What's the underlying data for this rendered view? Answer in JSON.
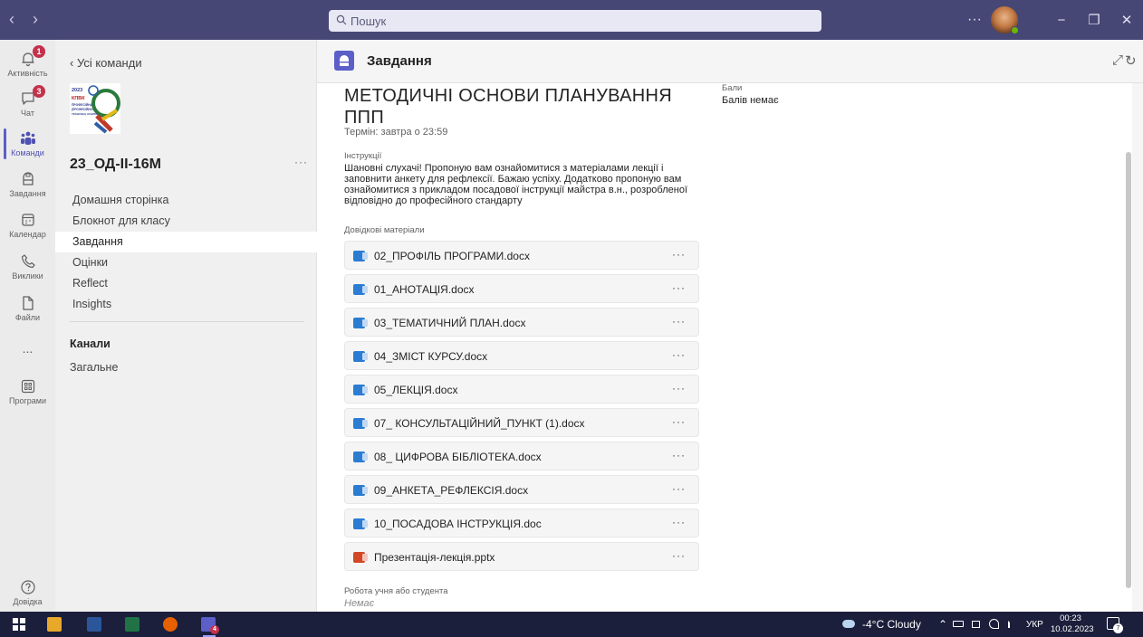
{
  "titlebar": {
    "back_arrow": "‹",
    "forward_arrow": "›",
    "search_placeholder": "Пошук",
    "more": "···",
    "minimize": "−",
    "maximize": "❐",
    "close": "✕"
  },
  "rail": [
    {
      "label": "Активність",
      "icon": "bell-icon",
      "badge": "1"
    },
    {
      "label": "Чат",
      "icon": "chat-icon",
      "badge": "3"
    },
    {
      "label": "Команди",
      "icon": "teams-icon",
      "active": true
    },
    {
      "label": "Завдання",
      "icon": "assignments-icon"
    },
    {
      "label": "Календар",
      "icon": "calendar-icon"
    },
    {
      "label": "Виклики",
      "icon": "phone-icon"
    },
    {
      "label": "Файли",
      "icon": "file-icon"
    },
    {
      "label": "...",
      "icon": "more-icon"
    },
    {
      "label": "Програми",
      "icon": "apps-icon"
    },
    {
      "label": "Довідка",
      "icon": "help-icon"
    }
  ],
  "team": {
    "back_label": "‹  Усі команди",
    "name": "23_ОД-ІІ-16М",
    "more": "···",
    "logo_text": [
      "2023",
      "КПВК",
      "ПРОФЕСІЙНА",
      "(ПРОФЕСІЙНО-",
      "ТЕХНІЧНА) ОСВІТА"
    ],
    "nav": [
      "Домашня сторінка",
      "Блокнот для класу",
      "Завдання",
      "Оцінки",
      "Reflect",
      "Insights"
    ],
    "channels_heading": "Канали",
    "channels": [
      "Загальне"
    ]
  },
  "header": {
    "title": "Завдання",
    "expand_icon": "⤢",
    "refresh_icon": "↻"
  },
  "assignment": {
    "title": "МЕТОДИЧНІ ОСНОВИ ПЛАНУВАННЯ ППП",
    "due": "Термін: завтра о 23:59",
    "instructions_label": "Інструкції",
    "instructions": "Шановні слухачі! Пропоную вам ознайомитися з матеріалами лекції і заповнити анкету для рефлексії. Бажаю успіху. Додатково пропоную вам ознайомитися з прикладом посадової інструкції майстра в.н., розробленої відповідно до професійного стандарту",
    "points_label": "Бали",
    "points_value": "Балів немає",
    "materials_label": "Довідкові матеріали",
    "files": [
      {
        "name": "02_ПРОФІЛЬ ПРОГРАМИ.docx",
        "type": "doc"
      },
      {
        "name": "01_АНОТАЦІЯ.docx",
        "type": "doc"
      },
      {
        "name": "03_ТЕМАТИЧНИЙ ПЛАН.docx",
        "type": "doc"
      },
      {
        "name": "04_ЗМІСТ КУРСУ.docx",
        "type": "doc"
      },
      {
        "name": "05_ЛЕКЦІЯ.docx",
        "type": "doc"
      },
      {
        "name": "07_ КОНСУЛЬТАЦІЙНИЙ_ПУНКТ (1).docx",
        "type": "doc"
      },
      {
        "name": "08_ ЦИФРОВА БІБЛІОТЕКА.docx",
        "type": "doc"
      },
      {
        "name": "09_АНКЕТА_РЕФЛЕКСІЯ.docx",
        "type": "doc"
      },
      {
        "name": "10_ПОСАДОВА ІНСТРУКЦІЯ.doc",
        "type": "doc"
      },
      {
        "name": "Презентація-лекція.pptx",
        "type": "ppt"
      }
    ],
    "file_more": "···",
    "student_work_label": "Робота учня або студента",
    "student_work_value": "Немає"
  },
  "taskbar": {
    "weather": "-4°C  Cloudy",
    "language": "УКР",
    "time": "00:23",
    "date": "10.02.2023",
    "teams_badge": "4",
    "notifications": "7"
  },
  "colors": {
    "titlebar": "#464775",
    "accent": "#5b5fc7",
    "badge": "#c4314b",
    "taskbar": "#1b1f3b"
  }
}
